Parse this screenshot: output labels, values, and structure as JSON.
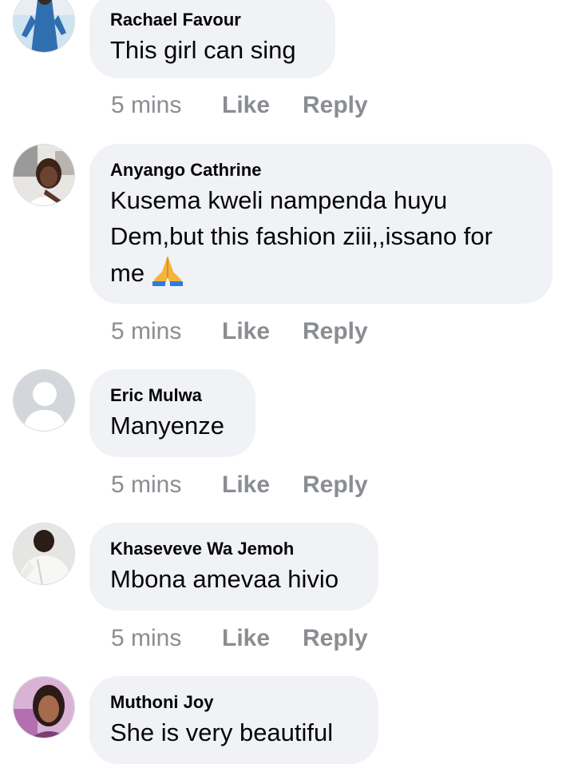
{
  "comments": [
    {
      "author": "Rachael Favour",
      "lines": [
        "This girl can sing"
      ],
      "time": "5 mins",
      "like_label": "Like",
      "reply_label": "Reply"
    },
    {
      "author": "Anyango Cathrine",
      "lines": [
        "Kusema kweli nampenda huyu",
        "Dem,but this fashion ziii,,issano for",
        "me"
      ],
      "emoji": "folded-hands-icon",
      "time": "5 mins",
      "like_label": "Like",
      "reply_label": "Reply"
    },
    {
      "author": "Eric Mulwa",
      "lines": [
        "Manyenze"
      ],
      "time": "5 mins",
      "like_label": "Like",
      "reply_label": "Reply"
    },
    {
      "author": "Khaseveve Wa Jemoh",
      "lines": [
        "Mbona amevaa hivio"
      ],
      "time": "5 mins",
      "like_label": "Like",
      "reply_label": "Reply"
    },
    {
      "author": "Muthoni Joy",
      "lines": [
        "She is very beautiful"
      ]
    }
  ],
  "colors": {
    "bubble": "#f0f2f5",
    "text": "#050505",
    "meta": "#8a8d91"
  }
}
